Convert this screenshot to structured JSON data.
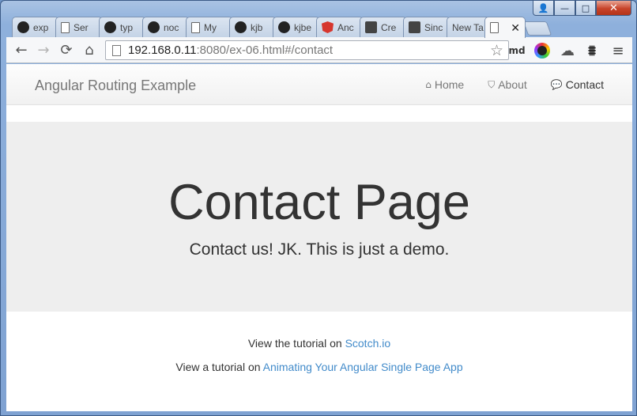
{
  "window": {
    "controls": {
      "user": "👤",
      "minimize": "—",
      "maximize": "□",
      "close": "✕"
    }
  },
  "tabs": [
    {
      "label": "exp",
      "icon": "github-icon"
    },
    {
      "label": "Ser",
      "icon": "document-icon"
    },
    {
      "label": "typ",
      "icon": "github-icon"
    },
    {
      "label": "noc",
      "icon": "github-icon"
    },
    {
      "label": "My",
      "icon": "document-icon"
    },
    {
      "label": "kjb",
      "icon": "github-icon"
    },
    {
      "label": "kjbe",
      "icon": "github-icon"
    },
    {
      "label": "Anc",
      "icon": "angular-icon"
    },
    {
      "label": "Cre",
      "icon": "creative-icon"
    },
    {
      "label": "Sinc",
      "icon": "creative-icon"
    },
    {
      "label": "New Ta",
      "icon": ""
    },
    {
      "label": "",
      "icon": "document-icon",
      "active": true,
      "close": "✕"
    }
  ],
  "toolbar": {
    "back": "←",
    "forward": "→",
    "reload": "⟳",
    "home": "⌂",
    "url_host": "192.168.0.11",
    "url_rest": ":8080/ex-06.html#/contact",
    "star": "☆",
    "extensions": {
      "md": "md",
      "cloud": "☁",
      "tower": "⩩",
      "menu": "≡"
    }
  },
  "page": {
    "brand": "Angular Routing Example",
    "nav": [
      {
        "icon": "⌂",
        "label": "Home",
        "active": false
      },
      {
        "icon": "⛉",
        "label": "About",
        "active": false
      },
      {
        "icon": "💬",
        "label": "Contact",
        "active": true
      }
    ],
    "jumbotron": {
      "title": "Contact Page",
      "subtitle": "Contact us! JK. This is just a demo."
    },
    "footer": {
      "line1_prefix": "View the tutorial on ",
      "line1_link": "Scotch.io",
      "line2_prefix": "View a tutorial on ",
      "line2_link": "Animating Your Angular Single Page App"
    }
  },
  "colors": {
    "link": "#428bca",
    "jumbotron_bg": "#eeeeee",
    "close_button": "#c7432a"
  }
}
